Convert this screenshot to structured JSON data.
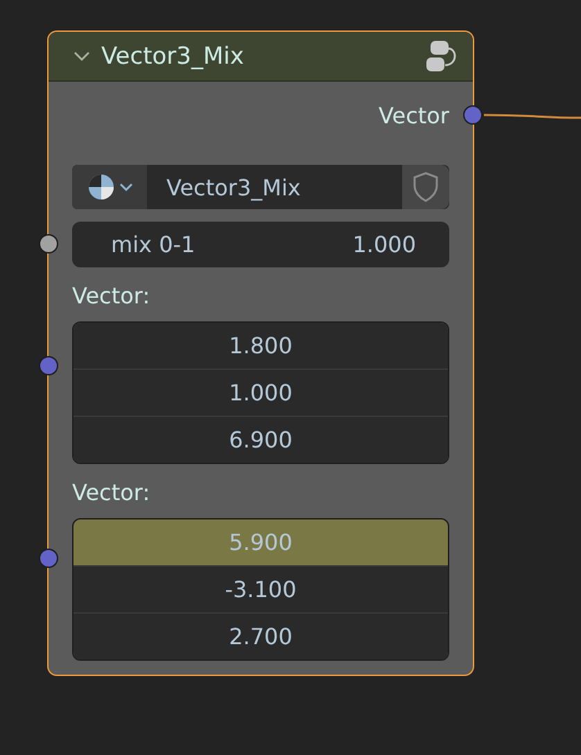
{
  "node": {
    "title": "Vector3_Mix",
    "selected": true,
    "expanded": true,
    "outputs": [
      {
        "label": "Vector",
        "color": "#6363c7"
      }
    ],
    "datablock": {
      "name": "Vector3_Mix",
      "fake_user": false
    },
    "inputs": [
      {
        "kind": "float",
        "color": "#a1a1a1",
        "label": "mix 0-1",
        "value": "1.000"
      },
      {
        "kind": "vector",
        "color": "#6363c7",
        "label": "Vector:",
        "components": [
          {
            "value": "1.800",
            "highlighted": false
          },
          {
            "value": "1.000",
            "highlighted": false
          },
          {
            "value": "6.900",
            "highlighted": false
          }
        ]
      },
      {
        "kind": "vector",
        "color": "#6363c7",
        "label": "Vector:",
        "components": [
          {
            "value": "5.900",
            "highlighted": true
          },
          {
            "value": "-3.100",
            "highlighted": false
          },
          {
            "value": "2.700",
            "highlighted": false
          }
        ]
      }
    ]
  }
}
